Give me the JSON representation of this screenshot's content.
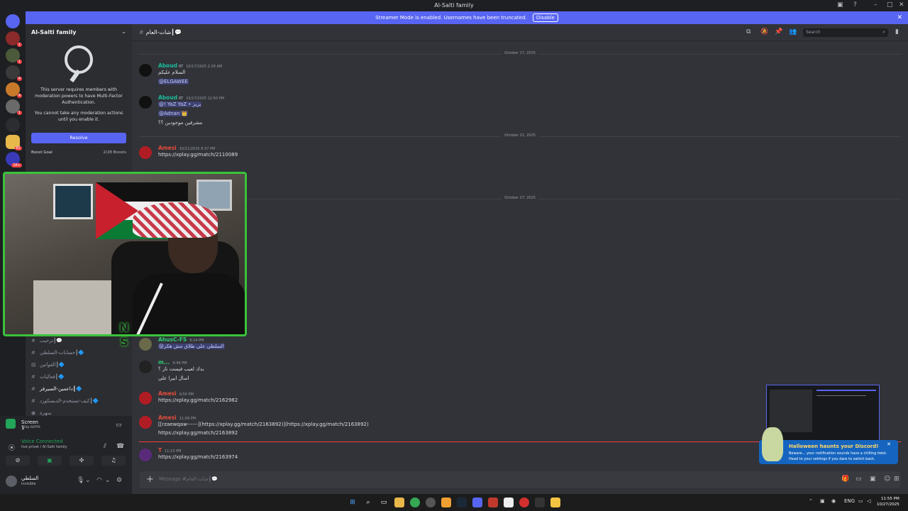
{
  "window": {
    "title": "Al-Salti family",
    "controls": [
      "minimize-icon",
      "maximize-icon",
      "close-icon"
    ]
  },
  "banner": {
    "text": "Streamer Mode is enabled. Usernames have been truncated.",
    "disable_label": "Disable"
  },
  "guild_badges": [
    "1",
    "1",
    "4",
    "4",
    "1",
    "4",
    "82",
    "1K+"
  ],
  "server": {
    "name": "Al-Salti family",
    "mfa_text_1": "This server requires members with moderation powers to have Multi-Factor Authentication.",
    "mfa_text_2": "You cannot take any moderation actions until you enable it.",
    "resolve_label": "Resolve",
    "boost_label": "Boost Goal",
    "boost_count": "2/28 Boosts"
  },
  "channels": [
    {
      "name": "ترحيب┃💬"
    },
    {
      "name": "حسابات-السلطي┃🔷"
    },
    {
      "name": "القوانين┃🔷"
    },
    {
      "name": "فعاليات┃🔷"
    },
    {
      "name": "داعمين-السيرفر┃🔷"
    },
    {
      "name": "كيف-تستخدم-الديسكورد┃🔷"
    },
    {
      "name": "سهرة"
    }
  ],
  "screen": {
    "name": "Screen 1",
    "sub": "720p 60FPS"
  },
  "voice": {
    "status": "Voice Connected",
    "channel": "live privet / Al-Salti family"
  },
  "user": {
    "name": "السلطي",
    "status": "Invisible"
  },
  "chat": {
    "channel_name": "شات-العام┃💬",
    "search_placeholder": "Search",
    "composer_placeholder": "Message #شات-العام┃💬",
    "dividers": [
      "October 17, 2025",
      "October 21, 2025",
      "October 27, 2025"
    ],
    "messages": [
      {
        "author": "Aboud",
        "role": "RT",
        "time": "10/17/2025 2:29 AM",
        "lines": [
          "السلام عليكم",
          "@ELGAWEE"
        ]
      },
      {
        "author": "Aboud",
        "role": "RT",
        "time": "10/17/2025 12:50 PM",
        "lines": [
          "@!        YaZ YaZ • يزيز",
          "@Adnan 👑",
          "مشرفين موجودين ؟؟"
        ]
      },
      {
        "author": "Amesi",
        "role": "",
        "time": "10/21/2025 8:37 PM",
        "lines": [
          "https://xplay.gg/match/2110089"
        ]
      },
      {
        "author": "AhusC-FS",
        "role": "",
        "time": "9:24 PM",
        "lines": [
          "@السلطي علي طلاق مش هكر"
        ]
      },
      {
        "author": "m...",
        "role": "",
        "time": "9:49 PM",
        "lines": [
          "بدك لعيب فيست ناز ؟",
          "اسال ابيرا علي"
        ]
      },
      {
        "author": "Amesi",
        "role": "",
        "time": "9:50 PM",
        "lines": [
          "https://xplay.gg/match/2162982"
        ]
      },
      {
        "author": "Amesi",
        "role": "",
        "time": "11:09 PM",
        "lines": [
          "[[rzaewqaw------](https://xplay.gg/match/2163892)](https://xplay.gg/match/2163892)",
          "https://xplay.gg/match/2163892"
        ]
      },
      {
        "author": "T",
        "role": "",
        "time": "11:15 PM",
        "lines": [
          "https://xplay.gg/match/2163974"
        ]
      }
    ]
  },
  "notification": {
    "title": "Halloween haunts your Discord!",
    "text": "Beware... your notification sounds have a chilling twist. Head to your settings if you dare to switch back."
  },
  "taskbar": {
    "lang": "ENG",
    "time": "11:55 PM",
    "date": "10/27/2025"
  },
  "colors": {
    "accent": "#5865f2",
    "voice_green": "#23a55a",
    "link": "#00a8fc",
    "author_aboud": "#1abc9c",
    "author_red": "#e74c3c"
  }
}
